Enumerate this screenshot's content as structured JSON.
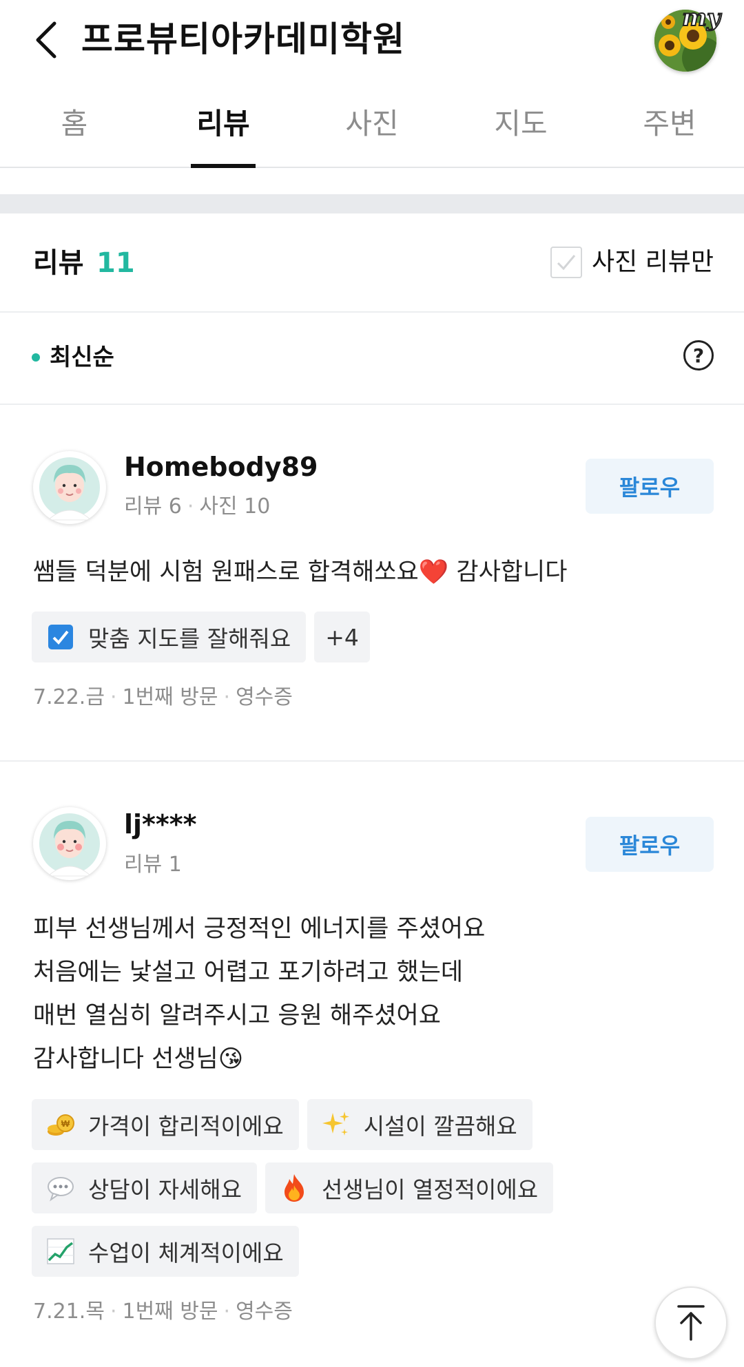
{
  "header": {
    "title": "프로뷰티아카데미학원",
    "my_badge": "my"
  },
  "tabs": [
    {
      "label": "홈",
      "active": false
    },
    {
      "label": "리뷰",
      "active": true
    },
    {
      "label": "사진",
      "active": false
    },
    {
      "label": "지도",
      "active": false
    },
    {
      "label": "주변",
      "active": false
    }
  ],
  "reviews_header": {
    "label": "리뷰",
    "count": "11",
    "photo_only_label": "사진 리뷰만",
    "photo_only_checked": false
  },
  "sort": {
    "label": "최신순",
    "help_icon": "?"
  },
  "reviews": [
    {
      "user": "Homebody89",
      "meta": [
        "리뷰 6",
        "사진 10"
      ],
      "follow_label": "팔로우",
      "text_lines": [
        "쌤들 덕분에 시험 원패스로 합격해쏘요❤️ 감사합니다"
      ],
      "chips": [
        {
          "icon": "check-box-icon",
          "label": "맞춤 지도를 잘해줘요"
        },
        {
          "icon": "",
          "label": "+4"
        }
      ],
      "footer": [
        "7.22.금",
        "1번째 방문",
        "영수증"
      ]
    },
    {
      "user": "lj****",
      "meta": [
        "리뷰 1"
      ],
      "follow_label": "팔로우",
      "text_lines": [
        "피부 선생님께서 긍정적인 에너지를 주셨어요",
        "처음에는 낯설고 어렵고 포기하려고 했는데",
        "매번 열심히 알려주시고 응원 해주셨어요",
        "감사합니다 선생님😘"
      ],
      "chips": [
        {
          "icon": "coins-icon",
          "label": "가격이 합리적이에요"
        },
        {
          "icon": "sparkles-icon",
          "label": "시설이 깔끔해요"
        },
        {
          "icon": "speech-bubble-icon",
          "label": "상담이 자세해요"
        },
        {
          "icon": "fire-icon",
          "label": "선생님이 열정적이에요"
        },
        {
          "icon": "chart-increasing-icon",
          "label": "수업이 체계적이에요"
        }
      ],
      "footer": [
        "7.21.목",
        "1번째 방문",
        "영수증"
      ]
    }
  ],
  "colors": {
    "accent": "#22b8a0",
    "follow_text": "#2a87d8",
    "follow_bg": "#eef5fb",
    "muted": "#8d8d8d"
  }
}
